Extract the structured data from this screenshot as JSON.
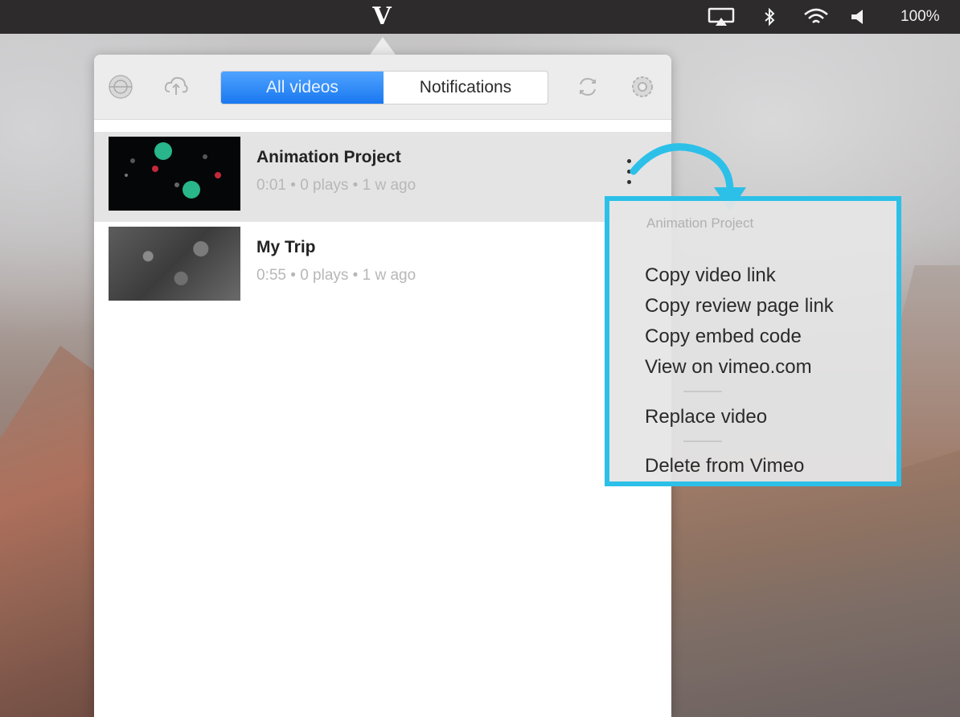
{
  "menubar": {
    "app_icon": "vimeo-logo",
    "logo_glyph": "V",
    "status_icons": [
      "airplay-icon",
      "bluetooth-icon",
      "wifi-icon",
      "volume-icon"
    ],
    "battery_text": "100%"
  },
  "toolbar": {
    "left_icons": [
      "globe-icon",
      "upload-icon"
    ],
    "right_icons": [
      "sync-icon",
      "gear-icon"
    ],
    "tabs": [
      {
        "label": "All videos",
        "active": true
      },
      {
        "label": "Notifications",
        "active": false
      }
    ],
    "accent_color": "#1a78f0"
  },
  "videos": [
    {
      "title": "Animation Project",
      "meta": "0:01 • 0 plays • 1 w ago",
      "selected": true
    },
    {
      "title": "My Trip",
      "meta": "0:55 • 0 plays • 1 w ago",
      "selected": false
    }
  ],
  "context_menu": {
    "header": "Animation Project",
    "groups": [
      [
        "Copy video link",
        "Copy review page link",
        "Copy embed code",
        "View on vimeo.com"
      ],
      [
        "Replace video"
      ],
      [
        "Delete from Vimeo"
      ]
    ],
    "highlight_color": "#2cc0e8"
  }
}
